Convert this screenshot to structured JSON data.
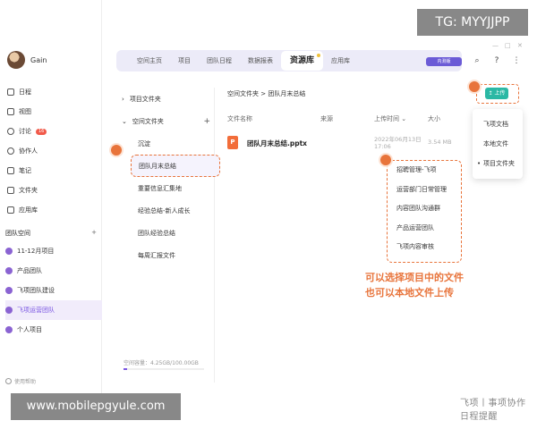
{
  "user": {
    "name": "Gain"
  },
  "nav": [
    {
      "label": "日程",
      "icon": "calendar-icon"
    },
    {
      "label": "视图",
      "icon": "view-icon"
    },
    {
      "label": "讨论",
      "icon": "chat-icon",
      "badge": "16"
    },
    {
      "label": "协作人",
      "icon": "people-icon"
    },
    {
      "label": "笔记",
      "icon": "note-icon"
    },
    {
      "label": "文件夹",
      "icon": "folder-icon"
    },
    {
      "label": "应用库",
      "icon": "apps-icon"
    }
  ],
  "team": {
    "header": "团队空间",
    "add": "+",
    "items": [
      "11-12月项目",
      "产品团队",
      "飞项团队建设",
      "飞项运营团队",
      "个人项目"
    ]
  },
  "help": "使用帮助",
  "tabs": [
    "空间主页",
    "项目",
    "团队日程",
    "数据报表",
    "资源库",
    "应用库"
  ],
  "pill": "内测版",
  "tree": {
    "project_folder": "项目文件夹",
    "space_folder": "空间文件夹",
    "add": "+",
    "children": [
      "沉淀",
      "团队月末总结",
      "重要信息汇集地",
      "经验总结-新人成长",
      "团队经验总结",
      "每周汇报文件"
    ]
  },
  "storage": "空间容量：4.25GB/100.00GB",
  "path": "空间文件夹 > 团队月末总结",
  "upload_label": "↥ 上传",
  "table": {
    "col_name": "文件名称",
    "col_source": "来源",
    "col_time": "上传时间 ⌄",
    "col_size": "大小"
  },
  "file": {
    "icon_letter": "P",
    "name": "团队月末总结.pptx",
    "date": "2022年06月13日",
    "time": "17:06",
    "size": "3.54 MB"
  },
  "dropdown": [
    "飞项文档",
    "本地文件",
    "项目文件夹"
  ],
  "project_folders": [
    "招聘管理-飞项",
    "运营部门日常管理",
    "内容团队沟通群",
    "产品运营团队",
    "飞项内容审核"
  ],
  "callout": [
    "可以选择项目中的文件",
    "也可以本地文件上传"
  ],
  "watermark": "飞项丨事项协作日程提醒",
  "overlay_tg": "TG: MYYJJPP",
  "overlay_site": "www.mobilepgyule.com",
  "colors": {
    "accent": "#7a56e2",
    "annotation": "#e8743b",
    "upload": "#2bb8a4"
  }
}
